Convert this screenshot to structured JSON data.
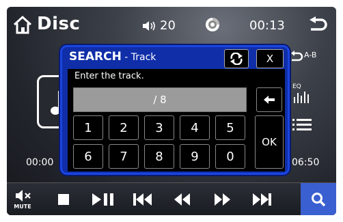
{
  "topbar": {
    "title": "Disc",
    "volume": "20",
    "clock": "00:13",
    "icons": {
      "home": "home-icon",
      "volume": "speaker-icon",
      "disc": "disc-icon",
      "back": "back-arrow-icon"
    }
  },
  "player": {
    "ab_label": "A-B",
    "eq_label": "EQ",
    "elapsed": "00:00",
    "total": "06:50"
  },
  "dialog": {
    "title": "SEARCH",
    "subtitle": " - Track",
    "close_label": "X",
    "prompt": "Enter the track.",
    "input_value": "/ 8",
    "ok_label": "OK",
    "keys_row1": [
      "1",
      "2",
      "3",
      "4",
      "5"
    ],
    "keys_row2": [
      "6",
      "7",
      "8",
      "9",
      "0"
    ]
  },
  "bottombar": {
    "mute_label": "MUTE",
    "accent_color": "#3a5fd0",
    "buttons": [
      "mute-icon",
      "stop-icon",
      "play-pause-icon",
      "skip-back-icon",
      "rewind-icon",
      "fast-forward-icon",
      "skip-forward-icon",
      "search-icon"
    ]
  },
  "colors": {
    "dialog_bg": "#0f2ea8",
    "dialog_border": "#1b45e0",
    "input_bg": "#9b9b9b"
  }
}
